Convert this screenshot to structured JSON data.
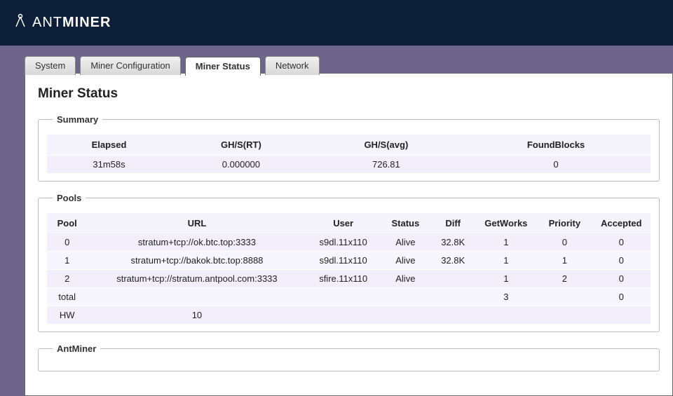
{
  "header": {
    "brand_prefix": "ANT",
    "brand_suffix": "MINER"
  },
  "tabs": [
    {
      "label": "System",
      "active": false
    },
    {
      "label": "Miner Configuration",
      "active": false
    },
    {
      "label": "Miner Status",
      "active": true
    },
    {
      "label": "Network",
      "active": false
    }
  ],
  "page": {
    "title": "Miner Status"
  },
  "sections": {
    "summary": {
      "legend": "Summary",
      "headers": [
        "Elapsed",
        "GH/S(RT)",
        "GH/S(avg)",
        "FoundBlocks"
      ],
      "row": [
        "31m58s",
        "0.000000",
        "726.81",
        "0"
      ]
    },
    "pools": {
      "legend": "Pools",
      "headers": [
        "Pool",
        "URL",
        "User",
        "Status",
        "Diff",
        "GetWorks",
        "Priority",
        "Accepted"
      ],
      "rows": [
        [
          "0",
          "stratum+tcp://ok.btc.top:3333",
          "s9dl.11x110",
          "Alive",
          "32.8K",
          "1",
          "0",
          "0"
        ],
        [
          "1",
          "stratum+tcp://bakok.btc.top:8888",
          "s9dl.11x110",
          "Alive",
          "32.8K",
          "1",
          "1",
          "0"
        ],
        [
          "2",
          "stratum+tcp://stratum.antpool.com:3333",
          "sfire.11x110",
          "Alive",
          "",
          "1",
          "2",
          "0"
        ],
        [
          "total",
          "",
          "",
          "",
          "",
          "3",
          "",
          "0"
        ],
        [
          "HW",
          "10",
          "",
          "",
          "",
          "",
          "",
          ""
        ]
      ]
    },
    "antminer": {
      "legend": "AntMiner"
    }
  }
}
